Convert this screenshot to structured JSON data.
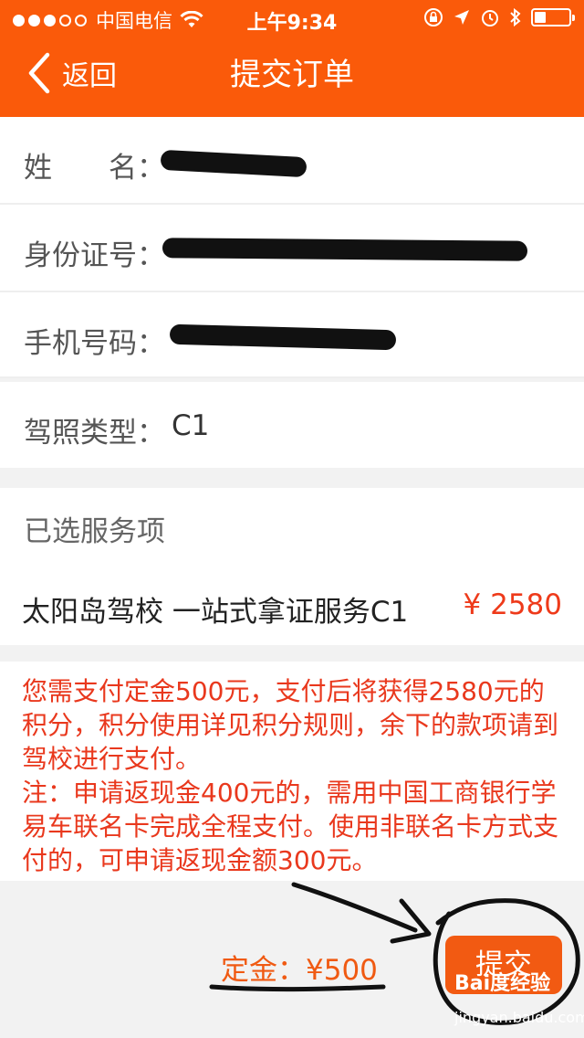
{
  "status_bar": {
    "carrier": "中国电信",
    "time": "上午9:34"
  },
  "nav": {
    "back_label": "返回",
    "title": "提交订单"
  },
  "form": {
    "name_label": "姓　　名：",
    "id_label": "身份证号：",
    "phone_label": "手机号码：",
    "license_label": "驾照类型：",
    "license_value": "C1"
  },
  "services": {
    "header": "已选服务项",
    "item_name": "太阳岛驾校  一站式拿证服务C1",
    "item_price": "¥ 2580"
  },
  "notice": {
    "line1": "您需支付定金500元，支付后将获得2580元的积分，积分使用详见积分规则，余下的款项请到驾校进行支付。",
    "line2": "注：申请返现金400元的，需用中国工商银行学易车联名卡完成全程支付。使用非联名卡方式支付的，可申请返现金额300元。"
  },
  "footer": {
    "deposit": "定金：¥500",
    "submit_label": "提交"
  },
  "watermark": {
    "brand": "Bai度经验",
    "url": "jingyan.baidu.com"
  },
  "colors": {
    "brand_orange": "#fa5a0a",
    "price_red": "#ee3a1a"
  }
}
